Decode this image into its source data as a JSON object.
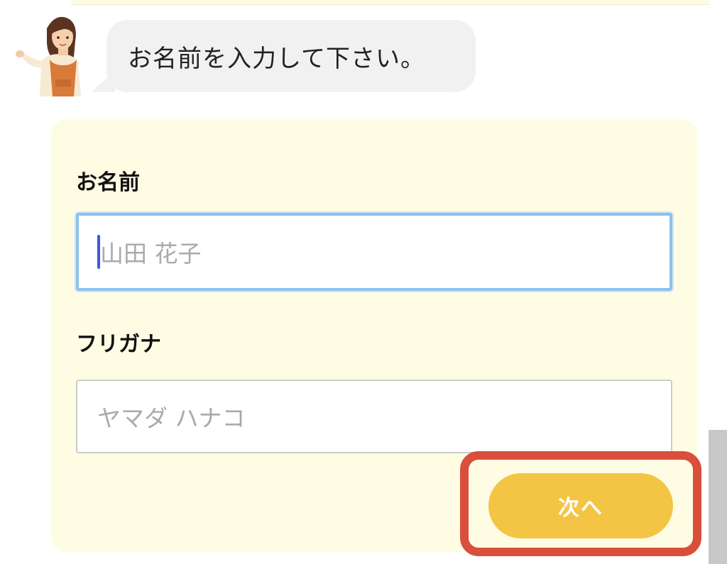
{
  "assistant": {
    "avatar_icon": "woman-in-apron-icon",
    "message": "お名前を入力して下さい。"
  },
  "form": {
    "name_field": {
      "label": "お名前",
      "value": "",
      "placeholder": "山田 花子",
      "focused": true
    },
    "kana_field": {
      "label": "フリガナ",
      "value": "",
      "placeholder": "ヤマダ ハナコ"
    },
    "next_button": {
      "label": "次へ",
      "highlighted": true
    }
  },
  "colors": {
    "card_background": "#fefce3",
    "bubble_background": "#f1f1f1",
    "button_background": "#f4c444",
    "highlight_border": "#d94f3b",
    "focus_border": "#8cc2ec",
    "caret": "#3b5bd9"
  }
}
